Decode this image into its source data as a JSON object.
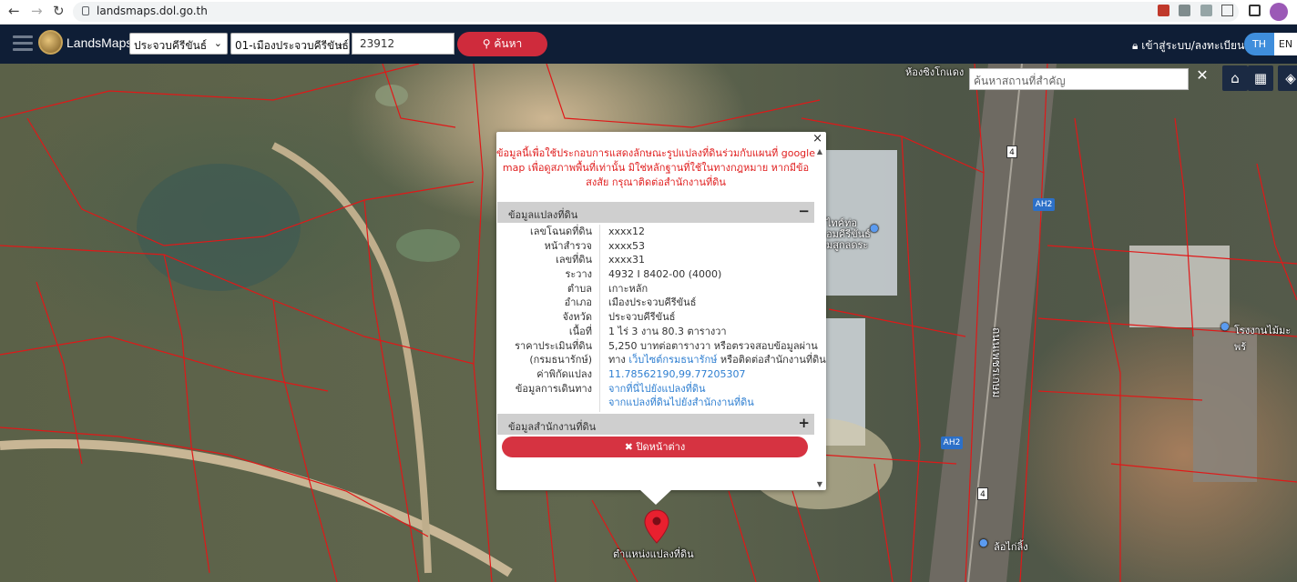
{
  "browser": {
    "url": "landsmaps.dol.go.th"
  },
  "navbar": {
    "brand": "LandsMaps",
    "province_select": "ประจวบคีรีขันธ์",
    "district_select": "01-เมืองประจวบคีรีขันธ์",
    "parcel_input": "23912",
    "search_label": "ค้นหา",
    "login_label": "เข้าสู่ระบบ/ลงทะเบียน",
    "lang_th": "TH",
    "lang_en": "EN"
  },
  "map": {
    "place_search_placeholder": "ค้นหาสถานที่สำคัญ",
    "labels": {
      "shop_top": "ห้องซิงโกแดง",
      "poi_left_1": "ไทค์ท่อ",
      "poi_left_2": "อมคีรีขันธ์",
      "poi_left_3": "มสูกลดระ",
      "road_name": "ถนนเพชรเกษม",
      "factory": "โรงงานไม้มะพร้",
      "tire_shop": "ล้อไก่ลิ้ง",
      "ah2_a": "AH2",
      "ah2_b": "AH2",
      "route_a": "4",
      "route_b": "4"
    }
  },
  "popup": {
    "disclaimer": "ข้อมูลนี้เพื่อใช้ประกอบการแสดงลักษณะรูปแปลงที่ดินร่วมกับแผนที่ google map เพื่อดูสภาพพื้นที่เท่านั้น มิใช่หลักฐานที่ใช้ในทางกฎหมาย หากมีข้อสงสัย กรุณาติดต่อสำนักงานที่ดิน",
    "section_land": "ข้อมูลแปลงที่ดิน",
    "section_office": "ข้อมูลสำนักงานที่ดิน",
    "fields": {
      "deed_no_label": "เลขโฉนดที่ดิน",
      "deed_no": "xxxx12",
      "survey_page_label": "หน้าสำรวจ",
      "survey_page": "xxxx53",
      "land_no_label": "เลขที่ดิน",
      "land_no": "xxxx31",
      "sheet_label": "ระวาง",
      "sheet": "4932 I 8402-00 (4000)",
      "subdistrict_label": "ตำบล",
      "subdistrict": "เกาะหลัก",
      "district_label": "อำเภอ",
      "district": "เมืองประจวบคีรีขันธ์",
      "province_label": "จังหวัด",
      "province": "ประจวบคีรีขันธ์",
      "area_label": "เนื้อที่",
      "area": "1 ไร่ 3 งาน 80.3 ตารางวา",
      "price_label": "ราคาประเมินที่ดิน",
      "price": "5,250 บาทต่อตารางวา หรือตรวจสอบข้อมูลผ่าน",
      "treasury_label": "(กรมธนารักษ์)",
      "treasury_prefix": "ทาง",
      "treasury_link": "เว็บไซต์กรมธนารักษ์",
      "treasury_suffix": "หรือติดต่อสำนักงานที่ดิน",
      "coord_label": "ค่าพิกัดแปลง",
      "coord": "11.78562190,99.77205307",
      "travel_label": "ข้อมูลการเดินทาง",
      "travel_to_parcel": "จากที่นี่ไปยังแปลงที่ดิน",
      "travel_to_office": "จากแปลงที่ดินไปยังสำนักงานที่ดิน"
    },
    "close_label": "ปิดหน้าต่าง"
  },
  "marker": {
    "label": "ตำแหน่งแปลงที่ดิน"
  }
}
